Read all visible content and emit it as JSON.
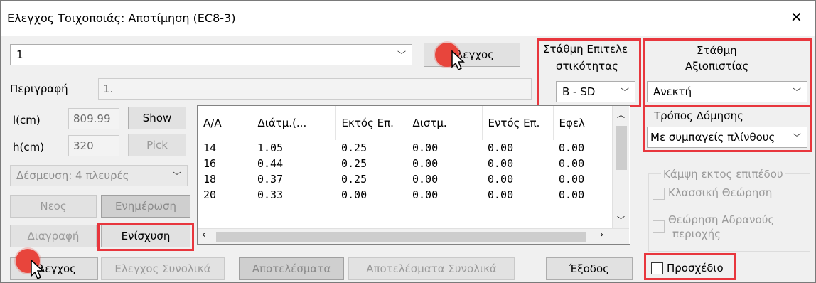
{
  "window": {
    "title": "Ελεγχος Τοιχοποιάς: Αποτίμηση (EC8-3)"
  },
  "selector": {
    "value": "1"
  },
  "check_button_top": "Ελεγχος",
  "performance_level": {
    "label_line1": "Στάθμη Επιτελε",
    "label_line2": "στικότητας",
    "value": "B - SD"
  },
  "reliability_level": {
    "label_line1": "Στάθμη",
    "label_line2": "Αξιοπιστίας",
    "value": "Ανεκτή"
  },
  "construction": {
    "label": "Τρόπος Δόμησης",
    "value": "Με συμπαγείς πλίνθους"
  },
  "description": {
    "label": "Περιγραφή",
    "value": "1."
  },
  "dims": {
    "l_label": "l(cm)",
    "l_value": "809.99",
    "h_label": "h(cm)",
    "h_value": "320",
    "show_button": "Show",
    "pick_button": "Pick"
  },
  "restraint": {
    "value": "Δέσμευση: 4 πλευρές"
  },
  "buttons": {
    "new": "Νεος",
    "update": "Ενημέρωση",
    "delete": "Διαγραφή",
    "reinforce": "Ενίσχυση",
    "check": "Ελεγχος",
    "check_total": "Ελεγχος Συνολικά",
    "results": "Αποτελέσματα",
    "results_total": "Αποτελέσματα Συνολικά",
    "exit": "Έξοδος"
  },
  "table": {
    "headers": [
      "Α/Α",
      "Διάτμ.(...",
      "Εκτός Επ.",
      "Διστμ.",
      "Εντός Επ.",
      "Εφελ"
    ],
    "rows": [
      [
        "14",
        "1.05",
        "0.25",
        "0.00",
        "0.00",
        "0.00"
      ],
      [
        "16",
        "0.44",
        "0.25",
        "0.00",
        "0.00",
        "0.00"
      ],
      [
        "18",
        "0.37",
        "0.25",
        "0.00",
        "0.00",
        "0.00"
      ],
      [
        "20",
        "0.33",
        "0.00",
        "0.00",
        "0.00",
        "0.00"
      ]
    ]
  },
  "bending_group": {
    "title": "Κάμψη εκτος επιπέδου",
    "classic": "Κλασσική Θεώρηση",
    "inertia_line1": "Θεώρηση Αδρανούς",
    "inertia_line2": "περιοχής"
  },
  "draft": {
    "label": "Προσχέδιο"
  },
  "colors": {
    "highlight": "#e8363d",
    "cursor_dot": "#e8453c"
  }
}
